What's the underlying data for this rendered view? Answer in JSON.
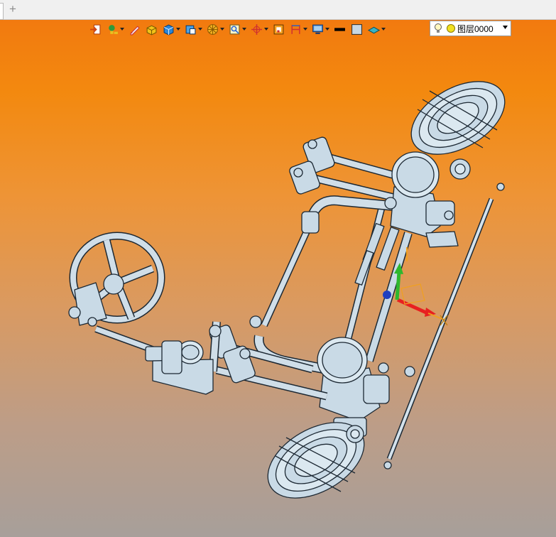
{
  "tabbar": {
    "new_tab_glyph": "+"
  },
  "toolbar": {
    "buttons": [
      {
        "name": "exit-icon",
        "dropdown": false
      },
      {
        "name": "light-bulb-icon",
        "dropdown": true
      },
      {
        "name": "pencil-icon",
        "dropdown": false
      },
      {
        "name": "box-yellow-icon",
        "dropdown": false
      },
      {
        "name": "cube-blue-icon",
        "dropdown": true
      },
      {
        "name": "cube-view-icon",
        "dropdown": true
      },
      {
        "name": "section-wheel-icon",
        "dropdown": true
      },
      {
        "name": "zoom-fit-icon",
        "dropdown": true
      },
      {
        "name": "rotate-axis-icon",
        "dropdown": true
      },
      {
        "name": "frame-icon",
        "dropdown": false
      },
      {
        "name": "dimension-icon",
        "dropdown": true
      },
      {
        "name": "display-mode-icon",
        "dropdown": true
      },
      {
        "name": "line-color-icon",
        "dropdown": false
      },
      {
        "name": "fill-color-icon",
        "dropdown": false
      },
      {
        "name": "layer-plane-icon",
        "dropdown": true
      }
    ],
    "colors": {
      "line_color": "#000000",
      "fill_color": "#c8d8e4"
    }
  },
  "layer": {
    "label": "图层0000",
    "bulb_icon": "light-bulb-icon",
    "dot_icon": "layer-status-dot-icon"
  },
  "viewport": {
    "model": "steering-axle-assembly",
    "colors": {
      "gradient_top": "#f27a0f",
      "gradient_bottom": "#a79f9a",
      "part_fill": "#c9dae6",
      "part_stroke": "#1c2833"
    },
    "triad": {
      "x_color": "#e82020",
      "y_color": "#2eb82e",
      "z_color": "#1f3fbf",
      "handle_color": "#f0a020"
    }
  }
}
